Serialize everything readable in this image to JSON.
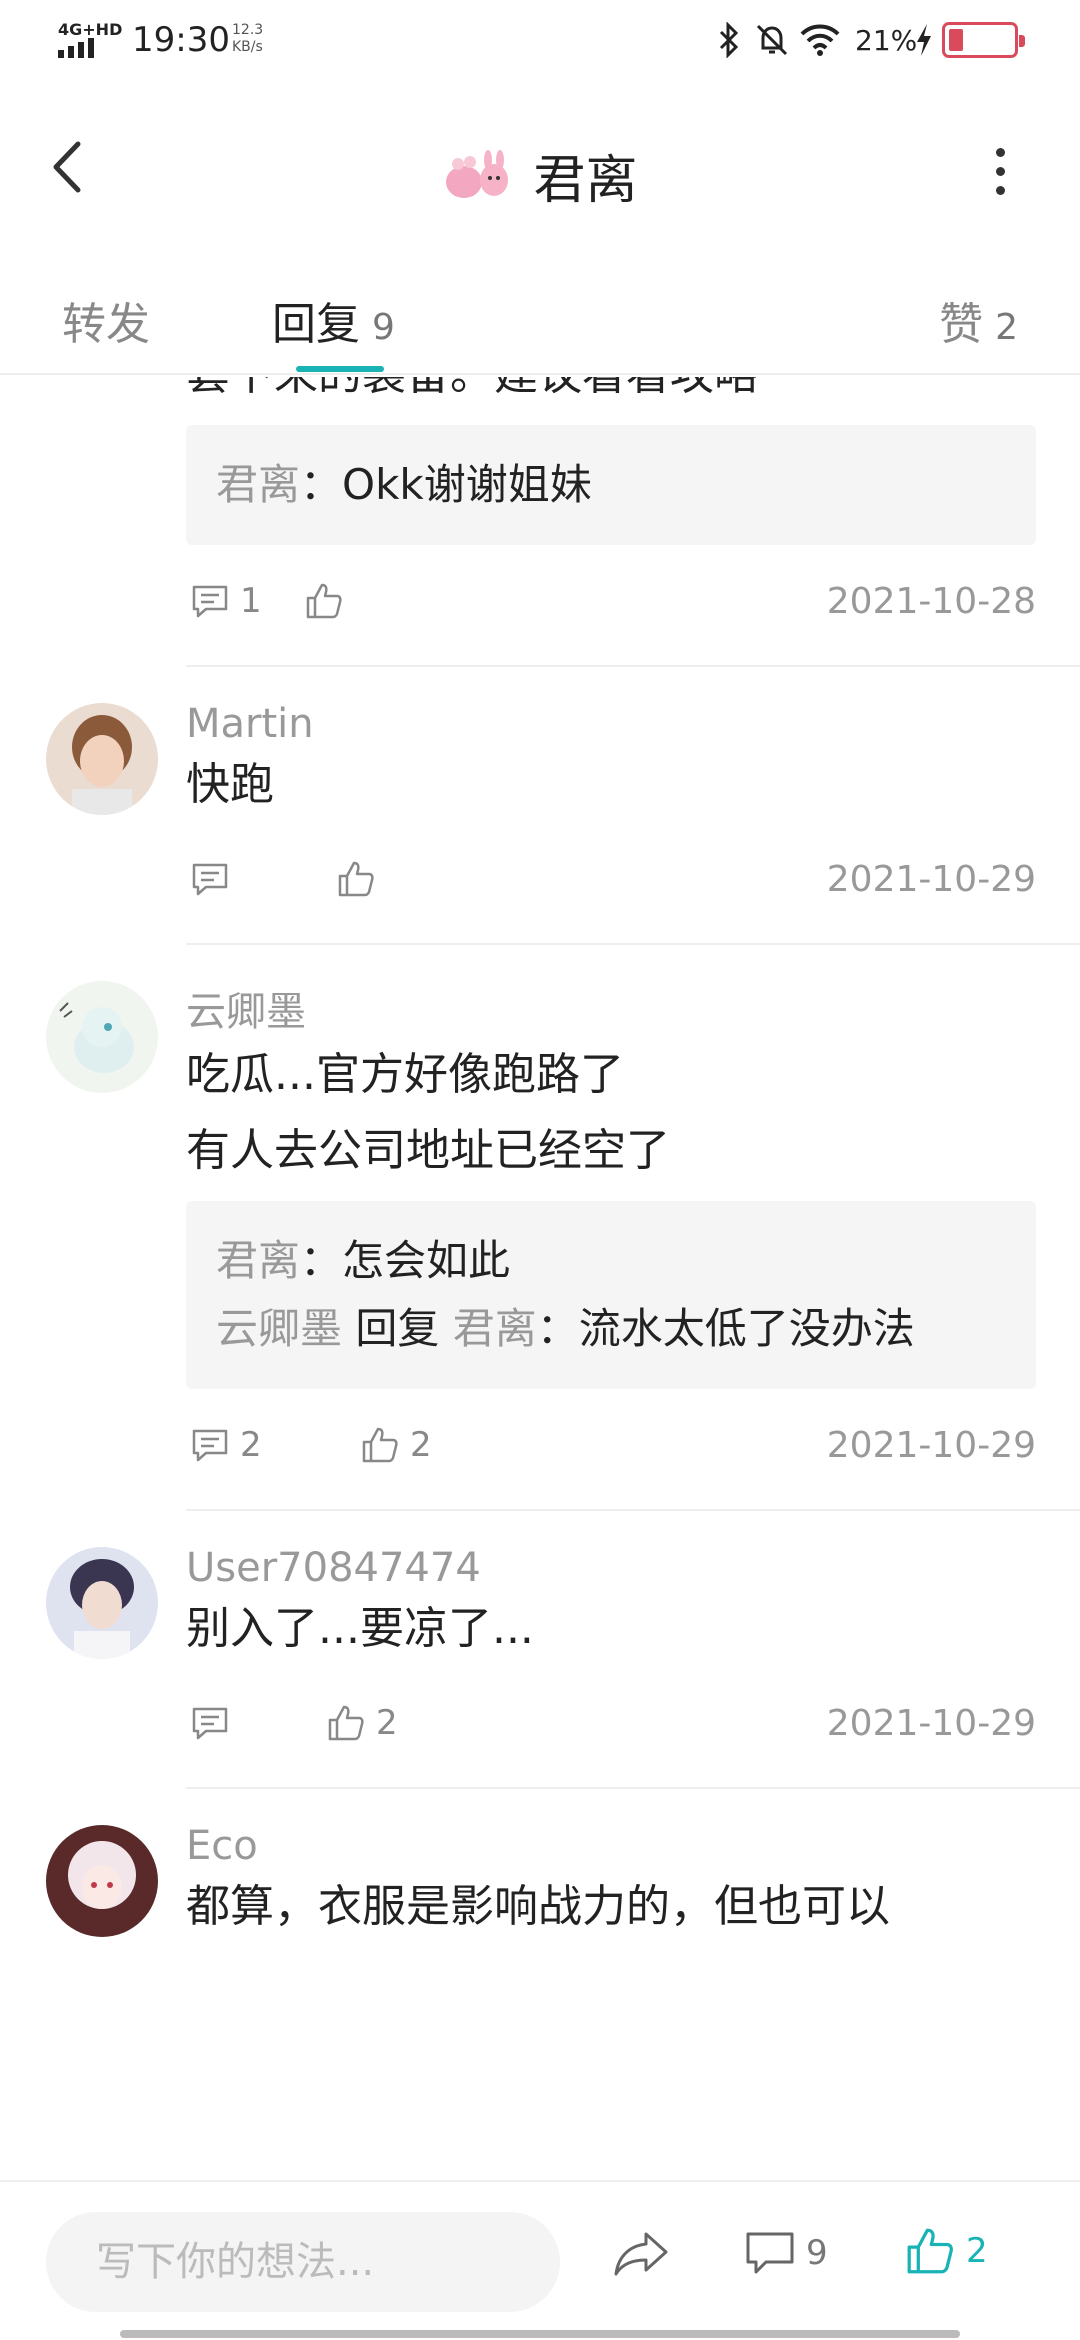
{
  "status_bar": {
    "network": "4G+HD",
    "time": "19:30",
    "speed": "12.3\nKB/s",
    "speed_value": "12.3",
    "speed_unit": "KB/s",
    "battery_pct": "21%",
    "battery_level": 0.21
  },
  "header": {
    "title": "君离"
  },
  "tabs": [
    {
      "label": "转发",
      "count": ""
    },
    {
      "label": "回复",
      "count": "9"
    },
    {
      "label": "赞",
      "count": "2"
    }
  ],
  "comments": [
    {
      "name": "",
      "text": "套下来的装备。建议看看攻略",
      "replies": [
        {
          "from": "君离",
          "to": "",
          "text": "：Okk谢谢姐妹"
        }
      ],
      "reply_count": "1",
      "like_count": "",
      "date": "2021-10-28"
    },
    {
      "name": "Martin",
      "text": "快跑",
      "replies": [],
      "reply_count": "",
      "like_count": "",
      "date": "2021-10-29"
    },
    {
      "name": "云卿墨",
      "text": "吃瓜...官方好像跑路了\n有人去公司地址已经空了",
      "text_line1": "吃瓜...官方好像跑路了",
      "text_line2": "有人去公司地址已经空了",
      "replies": [
        {
          "from": "君离",
          "to": "",
          "text": "：怎会如此"
        },
        {
          "from": "云卿墨",
          "reply_word": "回复",
          "to": "君离",
          "text": "：流水太低了没办法"
        }
      ],
      "reply_count": "2",
      "like_count": "2",
      "date": "2021-10-29"
    },
    {
      "name": "User70847474",
      "text": "别入了...要凉了...",
      "replies": [],
      "reply_count": "",
      "like_count": "2",
      "date": "2021-10-29"
    },
    {
      "name": "Eco",
      "text": "都算，衣服是影响战力的，但也可以",
      "replies": [],
      "reply_count": "",
      "like_count": "",
      "date": ""
    }
  ],
  "bottom_bar": {
    "input_placeholder": "写下你的想法...",
    "comment_count": "9",
    "like_count": "2"
  },
  "colors": {
    "accent": "#19b3b6",
    "battery_low": "#d94b5b",
    "muted_text": "#999999",
    "reply_bg": "#f5f5f5"
  },
  "icons": [
    "back-arrow-icon",
    "more-icon",
    "comment-icon",
    "thumbs-up-icon",
    "share-icon",
    "bluetooth-icon",
    "mute-bell-icon",
    "wifi-icon",
    "charging-icon"
  ]
}
